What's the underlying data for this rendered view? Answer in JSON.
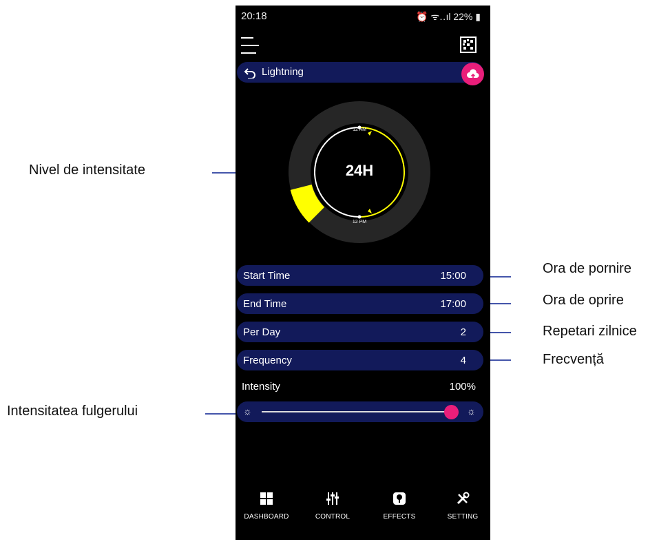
{
  "status_bar": {
    "time": "20:18",
    "battery": "22%"
  },
  "header": {
    "title": "Lightning"
  },
  "dial": {
    "center_label": "24H",
    "top_label": "12 AM",
    "bottom_label": "12 PM"
  },
  "rows": [
    {
      "label": "Start Time",
      "value": "15:00"
    },
    {
      "label": "End Time",
      "value": "17:00"
    },
    {
      "label": "Per Day",
      "value": "2"
    },
    {
      "label": "Frequency",
      "value": "4"
    }
  ],
  "intensity": {
    "label": "Intensity",
    "value": "100%",
    "level": 1.0
  },
  "nav": [
    {
      "label": "DASHBOARD",
      "icon": "dashboard-icon"
    },
    {
      "label": "CONTROL",
      "icon": "sliders-icon"
    },
    {
      "label": "EFFECTS",
      "icon": "effects-icon"
    },
    {
      "label": "SETTING",
      "icon": "tools-icon"
    }
  ],
  "callouts": {
    "intensity_level": "Nivel de intensitate",
    "start_time": "Ora de pornire",
    "end_time": "Ora de oprire",
    "daily_repeats": "Repetari zilnice",
    "frequency": "Frecvență",
    "lightning_intensity": "Intensitatea fulgerului"
  },
  "colors": {
    "accent": "#e91e7a",
    "bar": "#121a5a",
    "arc": "#ffff00",
    "background": "#000000"
  }
}
